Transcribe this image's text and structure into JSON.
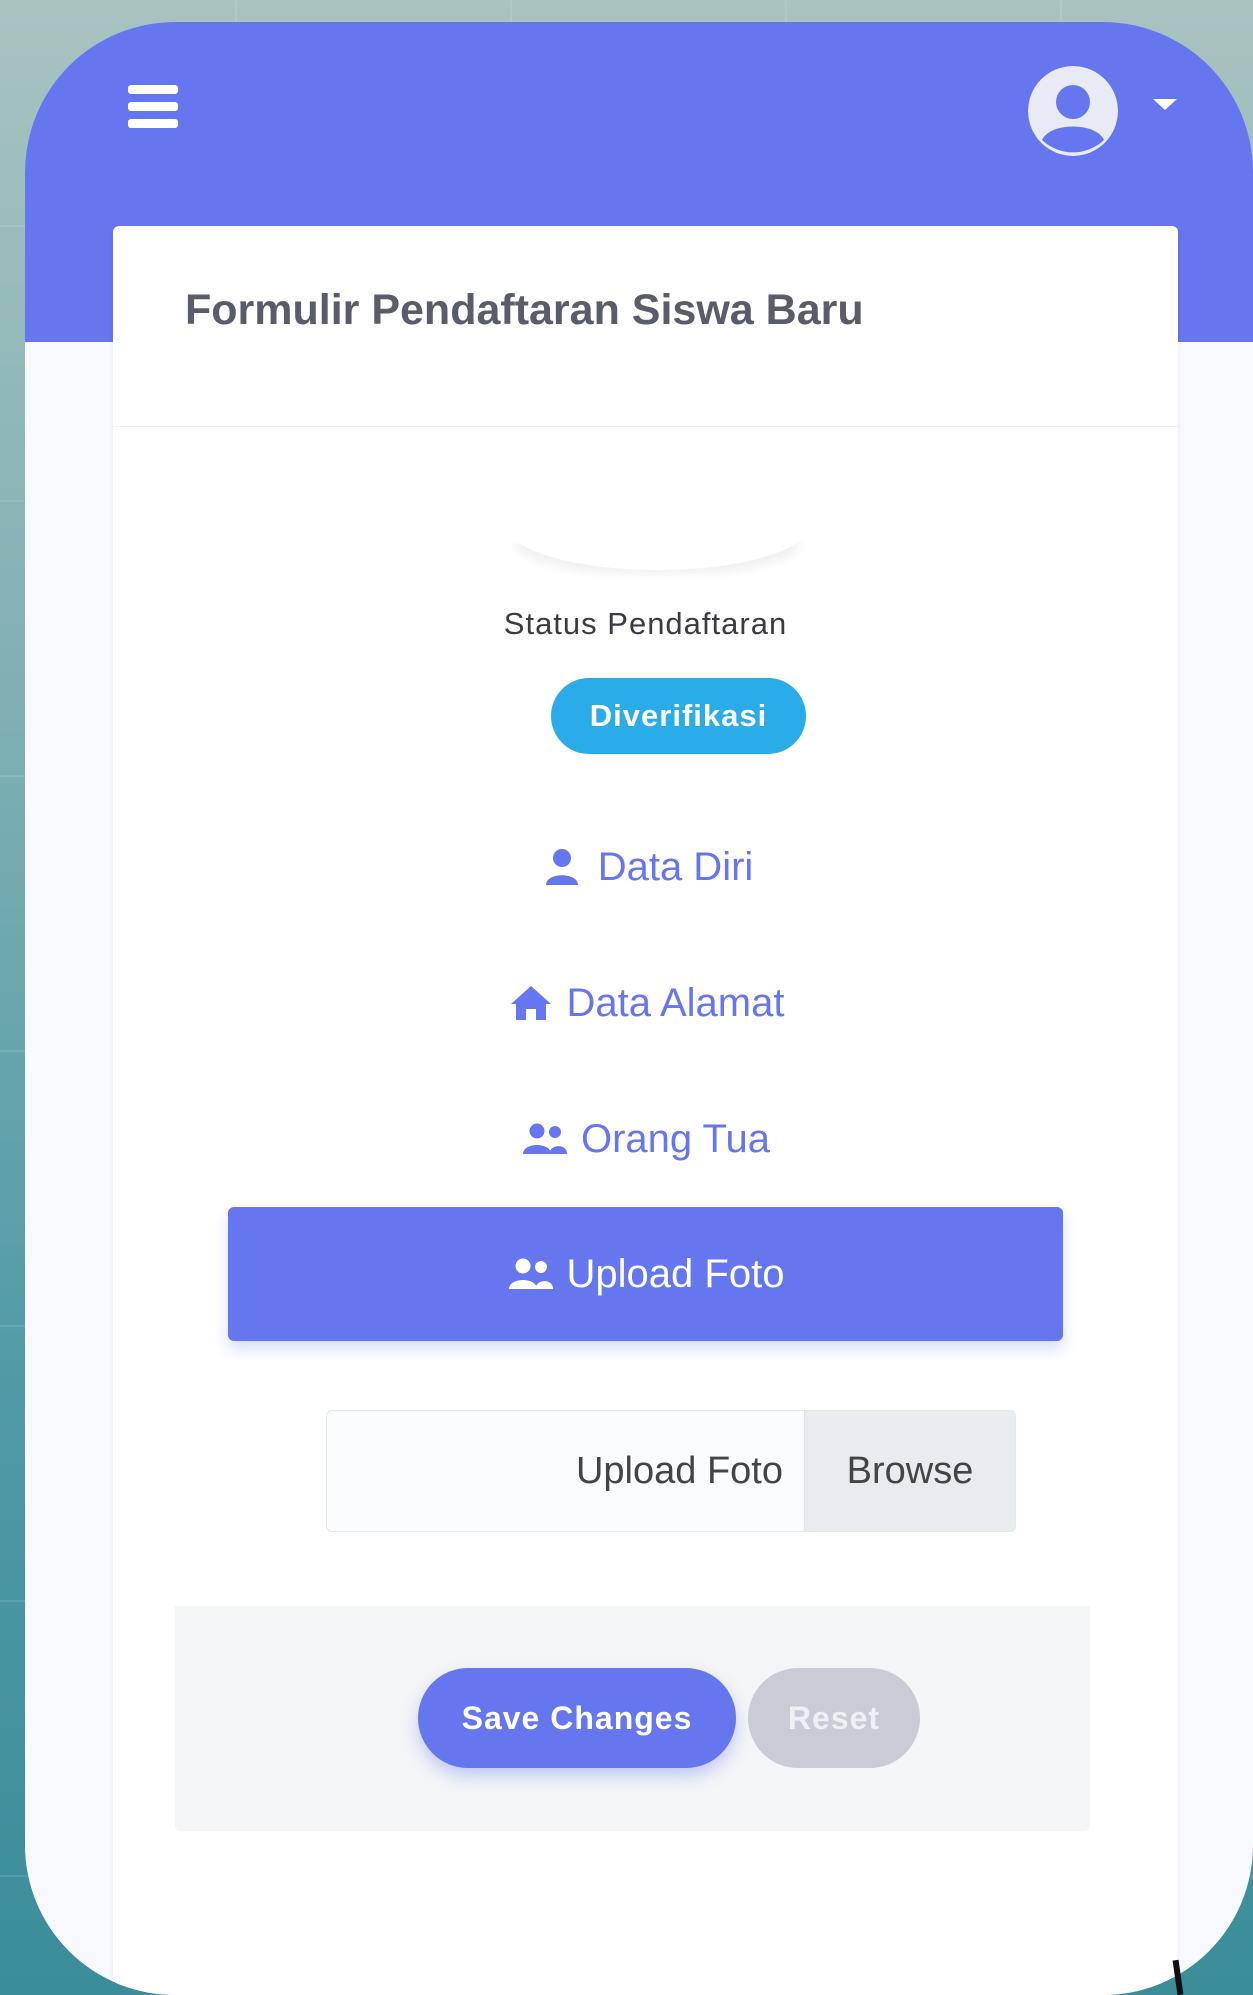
{
  "header": {
    "menu_icon": "hamburger-icon",
    "avatar_icon": "user-circle-icon",
    "dropdown_icon": "caret-down-icon",
    "colors": {
      "primary": "#6576ef",
      "on_primary": "#ffffff"
    }
  },
  "card": {
    "title": "Formulir Pendaftaran Siswa Baru",
    "status": {
      "label": "Status Pendaftaran",
      "badge": "Diverifikasi",
      "badge_color": "#2aace8"
    }
  },
  "tabs": [
    {
      "label": "Data Diri",
      "icon": "user-icon",
      "active": false
    },
    {
      "label": "Data Alamat",
      "icon": "home-icon",
      "active": false
    },
    {
      "label": "Orang Tua",
      "icon": "users-icon",
      "active": false
    },
    {
      "label": "Upload Foto",
      "icon": "users-icon",
      "active": true
    }
  ],
  "upload": {
    "placeholder": "Upload Foto",
    "browse_label": "Browse"
  },
  "actions": {
    "save_label": "Save Changes",
    "reset_label": "Reset"
  }
}
